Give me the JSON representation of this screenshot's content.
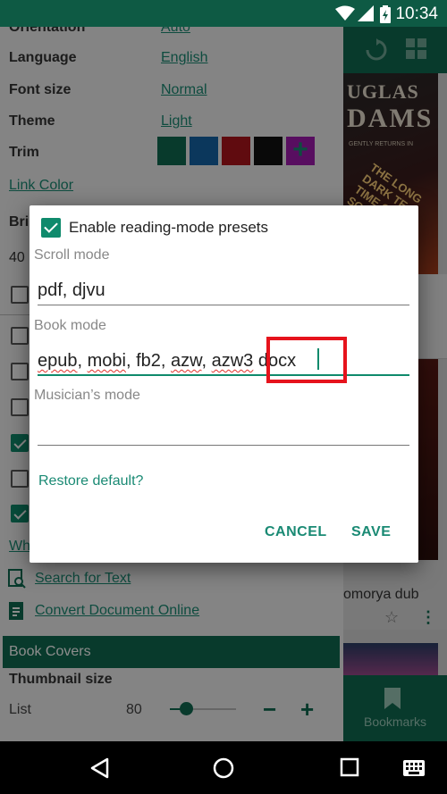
{
  "status_bar": {
    "time": "10:34"
  },
  "settings": {
    "orientation": {
      "label": "Orientation",
      "value": "Auto"
    },
    "language": {
      "label": "Language",
      "value": "English"
    },
    "font_size": {
      "label": "Font size",
      "value": "Normal"
    },
    "theme": {
      "label": "Theme",
      "value": "Light"
    },
    "trim": {
      "label": "Trim",
      "swatches": [
        "#0f6b51",
        "#1564a8",
        "#b0141d",
        "#111111",
        "#a01ab0"
      ],
      "plus": "+"
    },
    "link_color": "Link Color",
    "partial_label": "Bri",
    "partial_value": "40",
    "partial_link": "Wh",
    "search_for_text": "Search for Text",
    "convert_document": "Convert Document Online",
    "book_covers": "Book Covers",
    "thumbnail_size": "Thumbnail size",
    "list_label": "List",
    "list_value": "80",
    "minus": "−",
    "plus": "+"
  },
  "background": {
    "cover_line1": "UGLAS",
    "cover_line2": "DAMS",
    "cover_line3": "GENTLY RETURNS IN",
    "cover_line4": "THE LONG DARK TEA-TIME OF THE SOUL",
    "book_name": "omorya dub",
    "bookmarks": "Bookmarks"
  },
  "dialog": {
    "checkbox_label": "Enable reading-mode presets",
    "scroll_mode": {
      "label": "Scroll mode",
      "value": "pdf, djvu"
    },
    "book_mode": {
      "label": "Book mode",
      "tokens": [
        "epub",
        ", ",
        "mobi",
        ", fb2, ",
        "azw",
        ", ",
        "azw3",
        " docx"
      ]
    },
    "musicians_mode": {
      "label": "Musician’s mode",
      "value": ""
    },
    "restore": "Restore default?",
    "cancel": "CANCEL",
    "save": "SAVE"
  }
}
